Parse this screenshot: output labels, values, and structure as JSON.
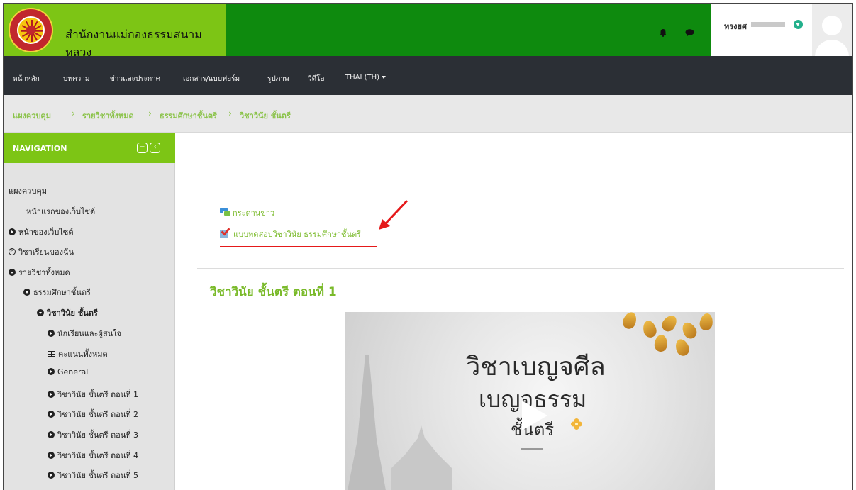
{
  "header": {
    "site_title": "สำนักงานแม่กองธรรมสนามหลวง",
    "user_name": "ทรงยศ"
  },
  "navbar": {
    "items": [
      "หน้าหลัก",
      "บทความ",
      "ข่าวและประกาศ",
      "เอกสาร/แบบฟอร์ม",
      "รูปภาพ",
      "วีดีโอ",
      "THAI (TH)"
    ]
  },
  "breadcrumb": [
    "แผงควบคุม",
    "รายวิชาทั้งหมด",
    "ธรรมศึกษาชั้นตรี",
    "วิชาวินัย ชั้นตรี"
  ],
  "sidebar": {
    "title": "NAVIGATION",
    "items": [
      {
        "label": "แผงควบคุม",
        "icon": "none"
      },
      {
        "label": "หน้าแรกของเว็บไซต์",
        "icon": "none"
      },
      {
        "label": "หน้าของเว็บไซต์",
        "icon": "chevron-right"
      },
      {
        "label": "วิชาเรียนของฉัน",
        "icon": "circled-double-chevron"
      },
      {
        "label": "รายวิชาทั้งหมด",
        "icon": "chevron-down"
      },
      {
        "label": "ธรรมศึกษาชั้นตรี",
        "icon": "chevron-down"
      },
      {
        "label": "วิชาวินัย ชั้นตรี",
        "icon": "chevron-down"
      },
      {
        "label": "นักเรียนและผู้สนใจ",
        "icon": "chevron-right"
      },
      {
        "label": "คะแนนทั้งหมด",
        "icon": "table"
      },
      {
        "label": "General",
        "icon": "chevron-right"
      },
      {
        "label": "วิชาวินัย ชั้นตรี ตอนที่ 1",
        "icon": "chevron-right"
      },
      {
        "label": "วิชาวินัย ชั้นตรี ตอนที่ 2",
        "icon": "chevron-right"
      },
      {
        "label": "วิชาวินัย ชั้นตรี ตอนที่ 3",
        "icon": "chevron-right"
      },
      {
        "label": "วิชาวินัย ชั้นตรี ตอนที่ 4",
        "icon": "chevron-right"
      },
      {
        "label": "วิชาวินัย ชั้นตรี ตอนที่ 5",
        "icon": "chevron-right"
      }
    ]
  },
  "main": {
    "activities": [
      {
        "label": "กระดานข่าว",
        "icon": "forum-icon"
      },
      {
        "label": "แบบทดสอบวิชาวินัย ธรรมศึกษาชั้นตรี",
        "icon": "quiz-icon"
      }
    ],
    "section_title": "วิชาวินัย ชั้นตรี ตอนที่ 1",
    "video": {
      "line1": "วิชาเบญจศีล",
      "line2": "เบญจธรรม",
      "line3": "ชั้นตรี"
    }
  },
  "colors": {
    "header_green": "#0e8a0e",
    "brand_lime": "#7dc515",
    "link_green": "#7aba2a",
    "navbar_dark": "#2b2f35",
    "annotation_red": "#e5191a"
  }
}
